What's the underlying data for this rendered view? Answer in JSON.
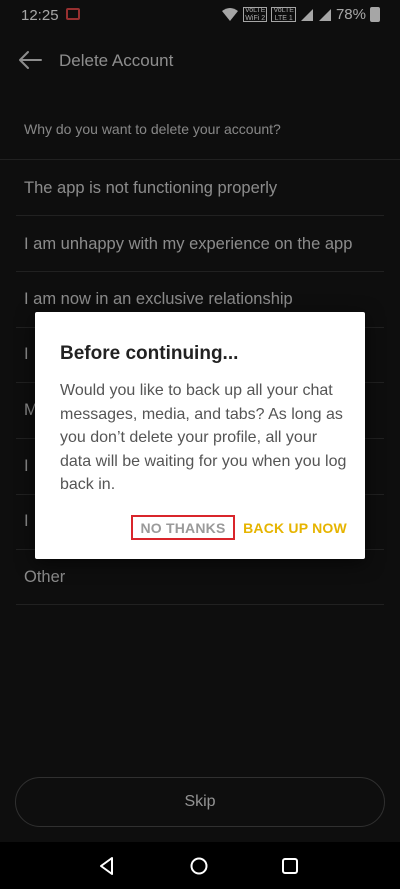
{
  "status_bar": {
    "time": "12:25",
    "battery": "78%",
    "net1_top": "VoLTE",
    "net1_bottom": "WiFi 2",
    "net2_top": "VoLTE",
    "net2_bottom": "LTE 1"
  },
  "app_bar": {
    "title": "Delete Account"
  },
  "question": "Why do you want to delete your account?",
  "reasons": [
    "The app is not functioning properly",
    "I am unhappy with my experience on the app",
    "I am now in an exclusive relationship",
    "I",
    "M",
    "I",
    "I",
    "Other"
  ],
  "dialog": {
    "title": "Before continuing...",
    "body": "Would you like to back up all your chat messages, media, and tabs? As long as you don’t delete your profile, all your data will be waiting for you when you log back in.",
    "no_label": "NO THANKS",
    "yes_label": "BACK UP NOW"
  },
  "skip_label": "Skip",
  "colors": {
    "background": "#161616",
    "accent": "#e6b400",
    "highlight_border": "#d9252b"
  }
}
